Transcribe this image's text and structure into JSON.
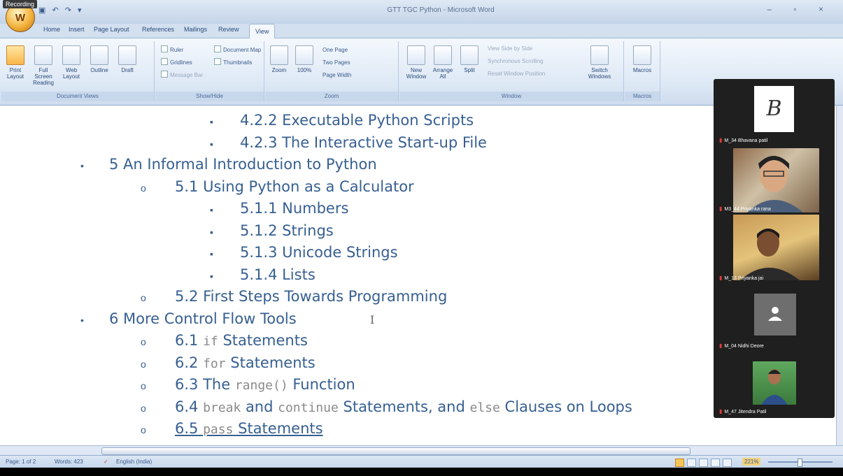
{
  "recording_label": "Recording",
  "window": {
    "title": "GTT TGC Python - Microsoft Word",
    "office_button": "W",
    "quick_access": "▣ ↶ ↷ ▾",
    "controls": "– ▫ ×"
  },
  "ribbon": {
    "tabs": [
      "Home",
      "Insert",
      "Page Layout",
      "References",
      "Mailings",
      "Review",
      "View"
    ],
    "active_tab": "View",
    "groups": {
      "document_views": {
        "label": "Document Views",
        "buttons": [
          "Print Layout",
          "Full Screen Reading",
          "Web Layout",
          "Outline",
          "Draft"
        ]
      },
      "show_hide": {
        "label": "Show/Hide",
        "items": [
          "Ruler",
          "Gridlines",
          "Message Bar",
          "Document Map",
          "Thumbnails"
        ]
      },
      "zoom": {
        "label": "Zoom",
        "buttons": [
          "Zoom",
          "100%"
        ],
        "small": [
          "One Page",
          "Two Pages",
          "Page Width"
        ]
      },
      "window": {
        "label": "Window",
        "buttons": [
          "New Window",
          "Arrange All",
          "Split"
        ],
        "small": [
          "View Side by Side",
          "Synchronous Scrolling",
          "Reset Window Position"
        ],
        "switch": "Switch Windows"
      },
      "macros": {
        "label": "Macros",
        "button": "Macros"
      }
    }
  },
  "document": {
    "lines": [
      {
        "level": 3,
        "text": "4.2.2 Executable Python Scripts"
      },
      {
        "level": 3,
        "text": "4.2.3 The Interactive Start-up File"
      },
      {
        "level": 1,
        "text": "5 An Informal Introduction to Python"
      },
      {
        "level": 2,
        "text": "5.1 Using Python as a Calculator"
      },
      {
        "level": 3,
        "text": "5.1.1 Numbers"
      },
      {
        "level": 3,
        "text": "5.1.2 Strings"
      },
      {
        "level": 3,
        "text": "5.1.3 Unicode Strings"
      },
      {
        "level": 3,
        "text": "5.1.4 Lists"
      },
      {
        "level": 2,
        "text": "5.2 First Steps Towards Programming"
      },
      {
        "level": 1,
        "text": "6 More Control Flow Tools"
      },
      {
        "level": 2,
        "parts": [
          {
            "t": "6.1 ",
            "code": false
          },
          {
            "t": "if",
            "code": true
          },
          {
            "t": " Statements",
            "code": false
          }
        ]
      },
      {
        "level": 2,
        "parts": [
          {
            "t": "6.2 ",
            "code": false
          },
          {
            "t": "for",
            "code": true
          },
          {
            "t": " Statements",
            "code": false
          }
        ]
      },
      {
        "level": 2,
        "parts": [
          {
            "t": "6.3 The ",
            "code": false
          },
          {
            "t": "range()",
            "code": true
          },
          {
            "t": " Function",
            "code": false
          }
        ]
      },
      {
        "level": 2,
        "parts": [
          {
            "t": "6.4 ",
            "code": false
          },
          {
            "t": "break",
            "code": true
          },
          {
            "t": " and ",
            "code": false
          },
          {
            "t": "continue",
            "code": true
          },
          {
            "t": " Statements, and ",
            "code": false
          },
          {
            "t": "else",
            "code": true
          },
          {
            "t": " Clauses on Loops",
            "code": false
          }
        ]
      },
      {
        "level": 2,
        "parts": [
          {
            "t": "6.5 ",
            "code": false
          },
          {
            "t": "pass",
            "code": true
          },
          {
            "t": " Statements",
            "code": false
          }
        ]
      }
    ],
    "bullets": {
      "level1": "•",
      "level2": "o",
      "level3": "▪"
    },
    "cursor": "I"
  },
  "statusbar": {
    "page": "Page: 1 of 2",
    "words": "Words: 423",
    "language": "English (India)",
    "zoom": "221%"
  },
  "participants": [
    {
      "name": "M_34 Bhavana patil",
      "type": "logo",
      "logo_letter": "B"
    },
    {
      "name": "M3_44 Priyanka rana",
      "type": "video"
    },
    {
      "name": "M_13 Priyanka jai",
      "type": "video"
    },
    {
      "name": "M_04 Nidhi Deore",
      "type": "avatar"
    },
    {
      "name": "M_47 Jitendra Patil",
      "type": "video"
    }
  ],
  "colors": {
    "heading_blue": "#365f91",
    "code_gray": "#8a8a8a",
    "ribbon_bg": "#dde8f5",
    "panel_bg": "#1f1f1f"
  }
}
